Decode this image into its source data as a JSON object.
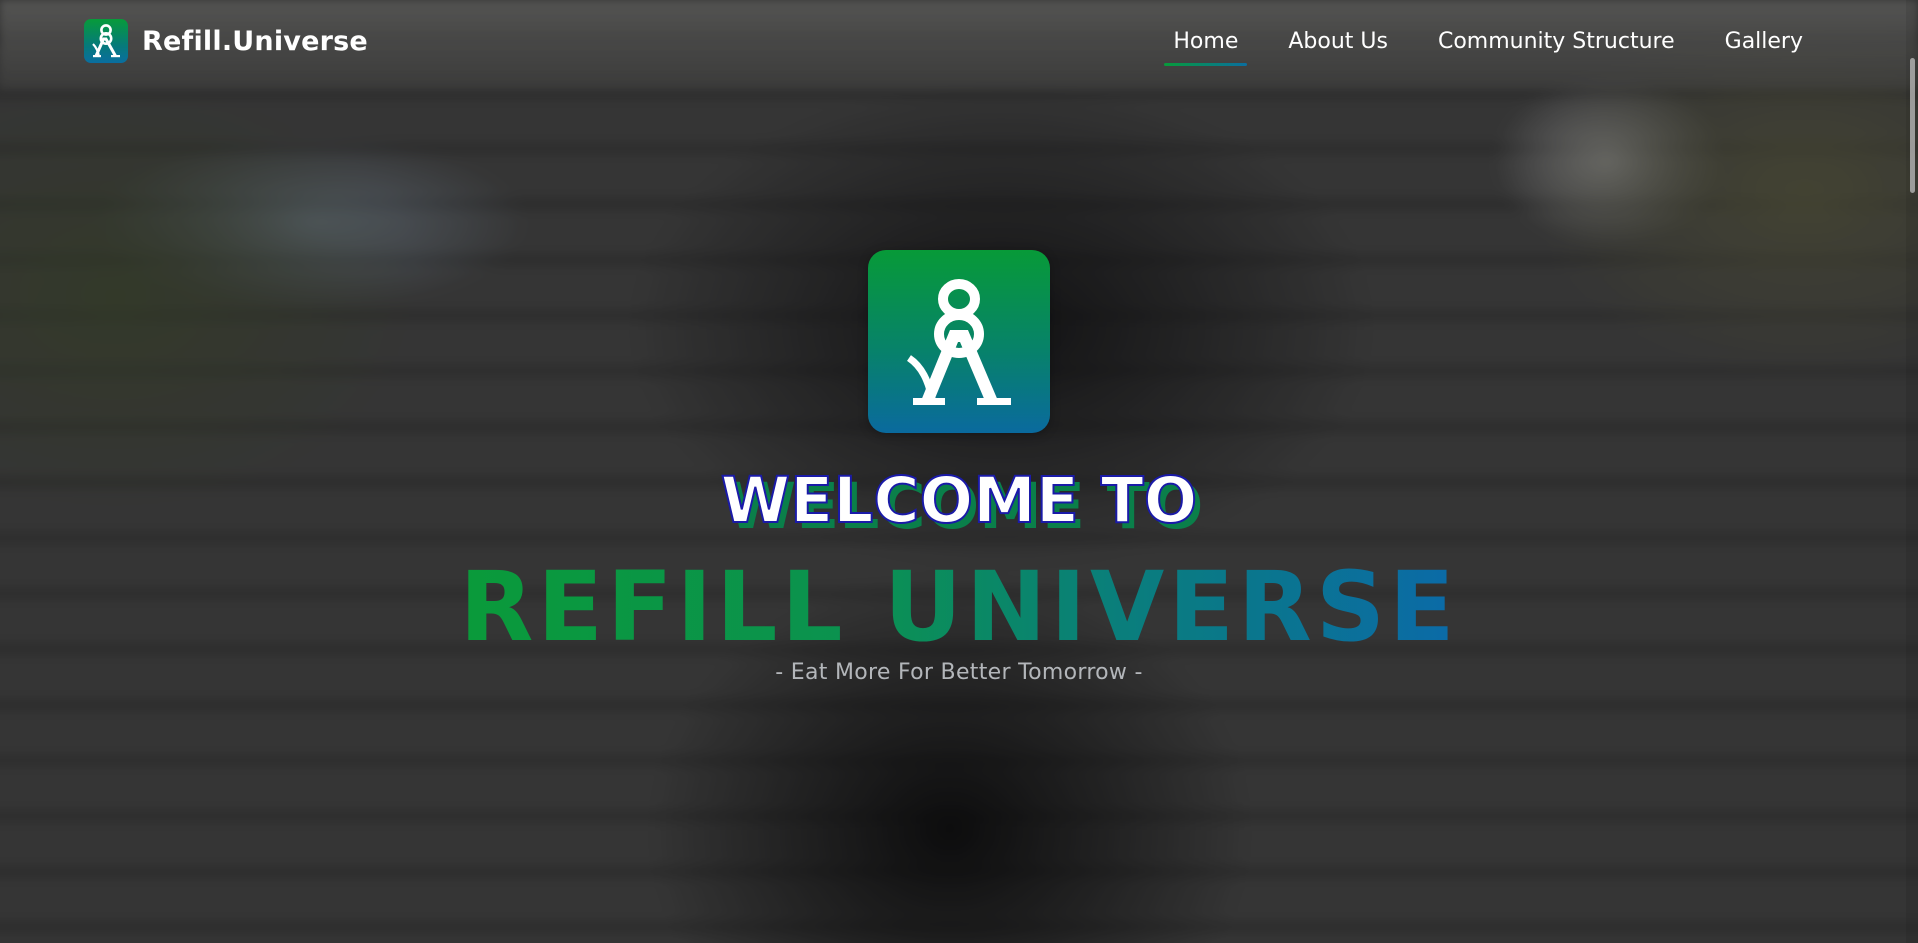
{
  "nav": {
    "brand": "Refill.Universe",
    "links": [
      {
        "label": "Home",
        "active": true
      },
      {
        "label": "About Us",
        "active": false
      },
      {
        "label": "Community Structure",
        "active": false
      },
      {
        "label": "Gallery",
        "active": false
      }
    ]
  },
  "hero": {
    "welcome": "WELCOME TO",
    "title": "REFILL UNIVERSE",
    "tagline": "- Eat More For Better Tomorrow -"
  },
  "colors": {
    "brand_green": "#079b3a",
    "brand_blue": "#0a6ea0",
    "welcome_stroke": "#1a1aa8"
  },
  "icons": {
    "brand_logo": "refill-universe-logo-icon",
    "hero_logo": "refill-universe-logo-icon"
  }
}
